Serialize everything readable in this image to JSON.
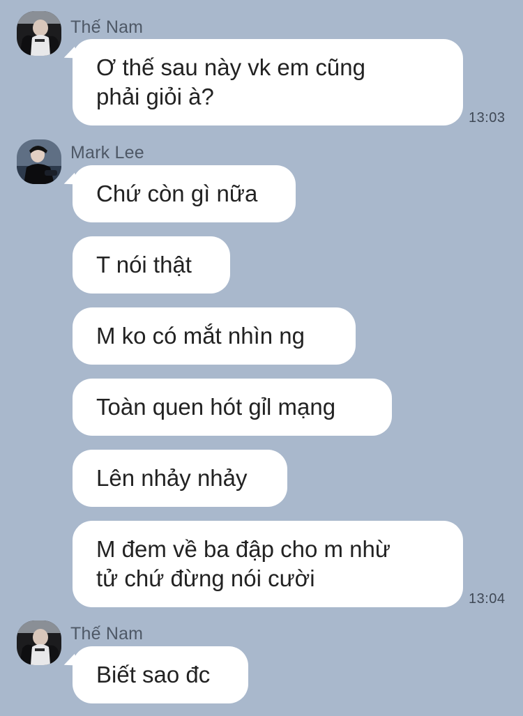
{
  "conversation": {
    "group1": {
      "sender": "Thế Nam",
      "messages": [
        {
          "lines": [
            "Ơ thế sau này vk em cũng",
            "phải giỏi à?"
          ],
          "time": "13:03"
        }
      ]
    },
    "group2": {
      "sender": "Mark Lee",
      "messages": [
        {
          "text": "Chứ còn gì nữa"
        },
        {
          "text": "T nói thật"
        },
        {
          "text": "M ko có mắt nhìn ng"
        },
        {
          "text": "Toàn quen hót gỉl mạng"
        },
        {
          "text": "Lên nhảy nhảy"
        },
        {
          "lines": [
            "M đem về ba đập cho m nhừ",
            "tử chứ đừng nói cười"
          ],
          "time": "13:04"
        }
      ]
    },
    "group3": {
      "sender": "Thế Nam",
      "messages": [
        {
          "text": "Biết sao đc"
        }
      ]
    }
  },
  "icons": {
    "avatar_the_nam": "avatar-photo-icon",
    "avatar_mark_lee": "avatar-photo-icon"
  },
  "colors": {
    "background": "#a9b8cc",
    "bubble": "#ffffff",
    "text": "#222222",
    "sender_name": "#4e5866",
    "timestamp": "#3f4855"
  }
}
